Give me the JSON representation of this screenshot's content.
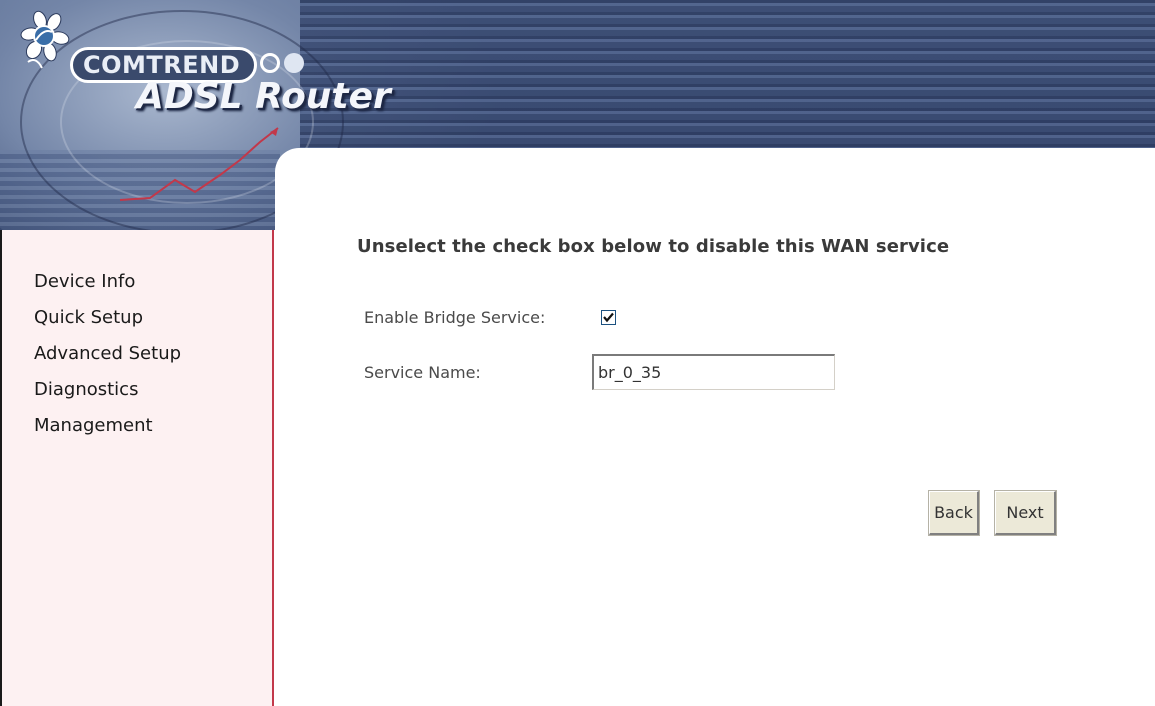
{
  "header": {
    "brand": "COMTREND",
    "product": "ADSL Router"
  },
  "sidebar": {
    "items": [
      {
        "label": "Device Info"
      },
      {
        "label": "Quick Setup"
      },
      {
        "label": "Advanced Setup"
      },
      {
        "label": "Diagnostics"
      },
      {
        "label": "Management"
      }
    ]
  },
  "main": {
    "title": "Unselect the check box below to disable this WAN service",
    "enable_bridge": {
      "label": "Enable Bridge Service:",
      "checked": true
    },
    "service_name": {
      "label": "Service Name:",
      "value": "br_0_35"
    },
    "buttons": {
      "back": "Back",
      "next": "Next"
    }
  },
  "colors": {
    "sidebar_bg": "#fdf1f2",
    "sidebar_border": "#c2384a",
    "banner_dark": "#2b3a5c"
  },
  "icons": {
    "logo": "flower-logo-icon",
    "checkmark": "checkmark-icon"
  }
}
